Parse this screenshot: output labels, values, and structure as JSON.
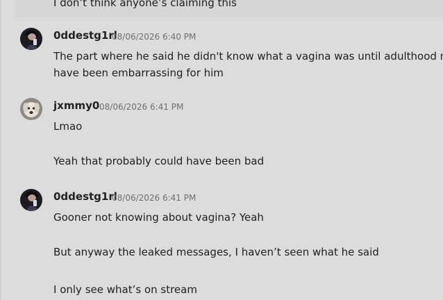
{
  "messages": [
    {
      "lines": [
        "I don’t think anyone’s claiming this"
      ]
    },
    {
      "username": "0ddestg1rl",
      "timestamp": "08/06/2026 6:40 PM",
      "avatar_icon": "dark-portrait-avatar-icon",
      "lines": [
        "The part where he said he didn't know what a vagina was until adulthood may",
        "have been embarrassing for him"
      ]
    },
    {
      "username": "jxmmy0",
      "timestamp": "08/06/2026 6:41 PM",
      "avatar_icon": "dog-avatar-icon",
      "lines": [
        "Lmao",
        "Yeah that probably could have been bad"
      ]
    },
    {
      "username": "0ddestg1rl",
      "timestamp": "08/06/2026 6:41 PM",
      "avatar_icon": "dark-portrait-avatar-icon",
      "lines": [
        "Gooner not knowing about vagina? Yeah",
        "But anyway the leaked messages, I haven’t seen what he said",
        "I only see what’s on stream"
      ]
    }
  ]
}
